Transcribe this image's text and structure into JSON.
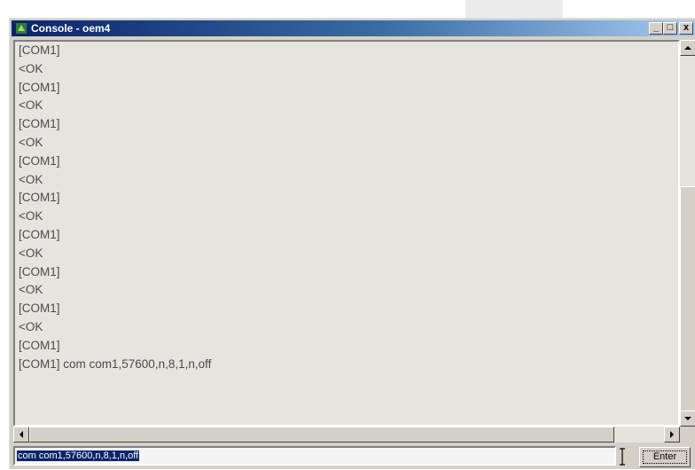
{
  "window": {
    "title": "Console - oem4",
    "controls": {
      "minimize": "_",
      "maximize": "□",
      "close": "x"
    }
  },
  "console": {
    "lines": [
      "[COM1]",
      "<OK",
      "[COM1]",
      "<OK",
      "[COM1]",
      "<OK",
      "[COM1]",
      "<OK",
      "[COM1]",
      "<OK",
      "[COM1]",
      "<OK",
      "[COM1]",
      "<OK",
      "[COM1]",
      "<OK",
      "[COM1]",
      "[COM1] com com1,57600,n,8,1,n,off"
    ]
  },
  "command": {
    "value": "com com1,57600,n,8,1,n,off",
    "enter_label": "Enter"
  },
  "icons": {
    "window": "console-app-icon",
    "scroll_up": "arrow-up-icon",
    "scroll_down": "arrow-down-icon",
    "scroll_left": "arrow-left-icon",
    "scroll_right": "arrow-right-icon",
    "cursor": "text-cursor-icon"
  },
  "colors": {
    "title_start": "#0a246a",
    "title_end": "#a6caf0",
    "window_face": "#d4d0c8",
    "selection": "#0a246a"
  }
}
